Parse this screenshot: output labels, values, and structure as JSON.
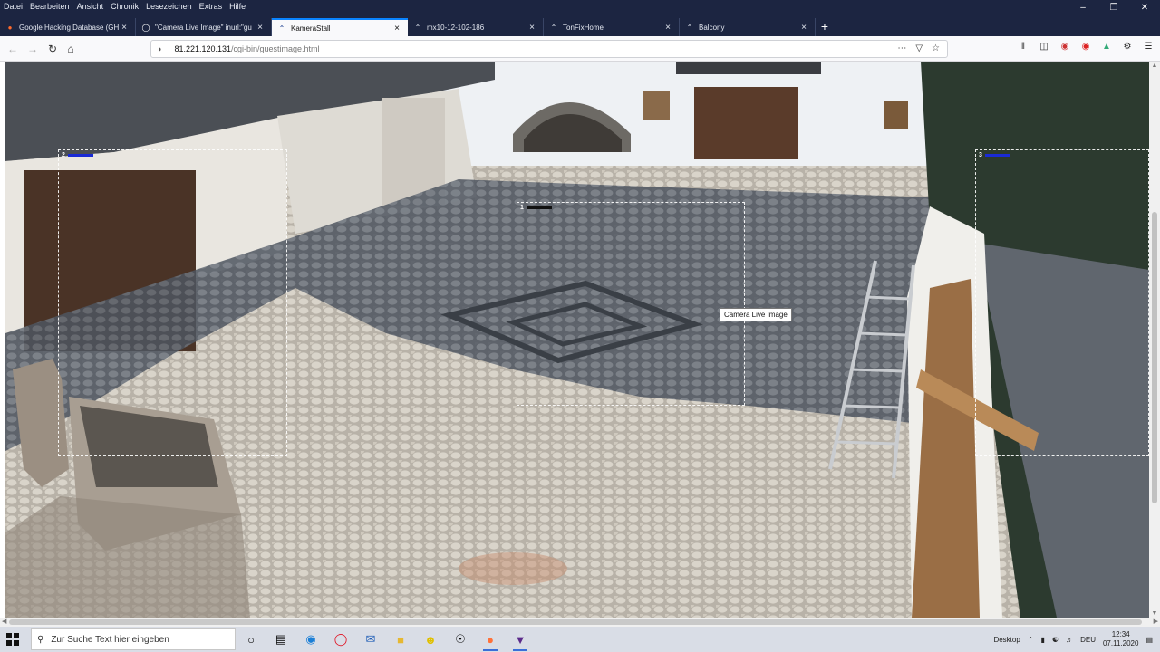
{
  "menu": [
    "Datei",
    "Bearbeiten",
    "Ansicht",
    "Chronik",
    "Lesezeichen",
    "Extras",
    "Hilfe"
  ],
  "tabs": [
    {
      "label": "Google Hacking Database (GH",
      "icon": "fire-icon",
      "active": false
    },
    {
      "label": "\"Camera Live Image\" inurl:\"gu",
      "icon": "google-icon",
      "active": false
    },
    {
      "label": "KameraStall",
      "icon": "axis-camera-icon",
      "active": true
    },
    {
      "label": "mx10-12-102-186",
      "icon": "axis-camera-icon",
      "active": false
    },
    {
      "label": "TonFixHome",
      "icon": "axis-camera-icon",
      "active": false
    },
    {
      "label": "Balcony",
      "icon": "axis-camera-icon",
      "active": false
    }
  ],
  "url": {
    "host": "81.221.120.131",
    "path": "/cgi-bin/guestimage.html"
  },
  "camera": {
    "tooltip": "Camera Live Image",
    "zones": [
      {
        "label": "2",
        "bar_color": "#1a2bd6"
      },
      {
        "label": "1",
        "bar_color": "#111111"
      },
      {
        "label": "3",
        "bar_color": "#1a2bd6"
      }
    ]
  },
  "taskbar": {
    "search_placeholder": "Zur Suche Text hier eingeben",
    "desktop_label": "Desktop",
    "lang": "DEU",
    "time": "12:34",
    "date": "07.11.2020"
  },
  "colors": {
    "titlebar": "#1c2541",
    "accent": "#0a84ff",
    "taskbar": "#d9dde6"
  }
}
